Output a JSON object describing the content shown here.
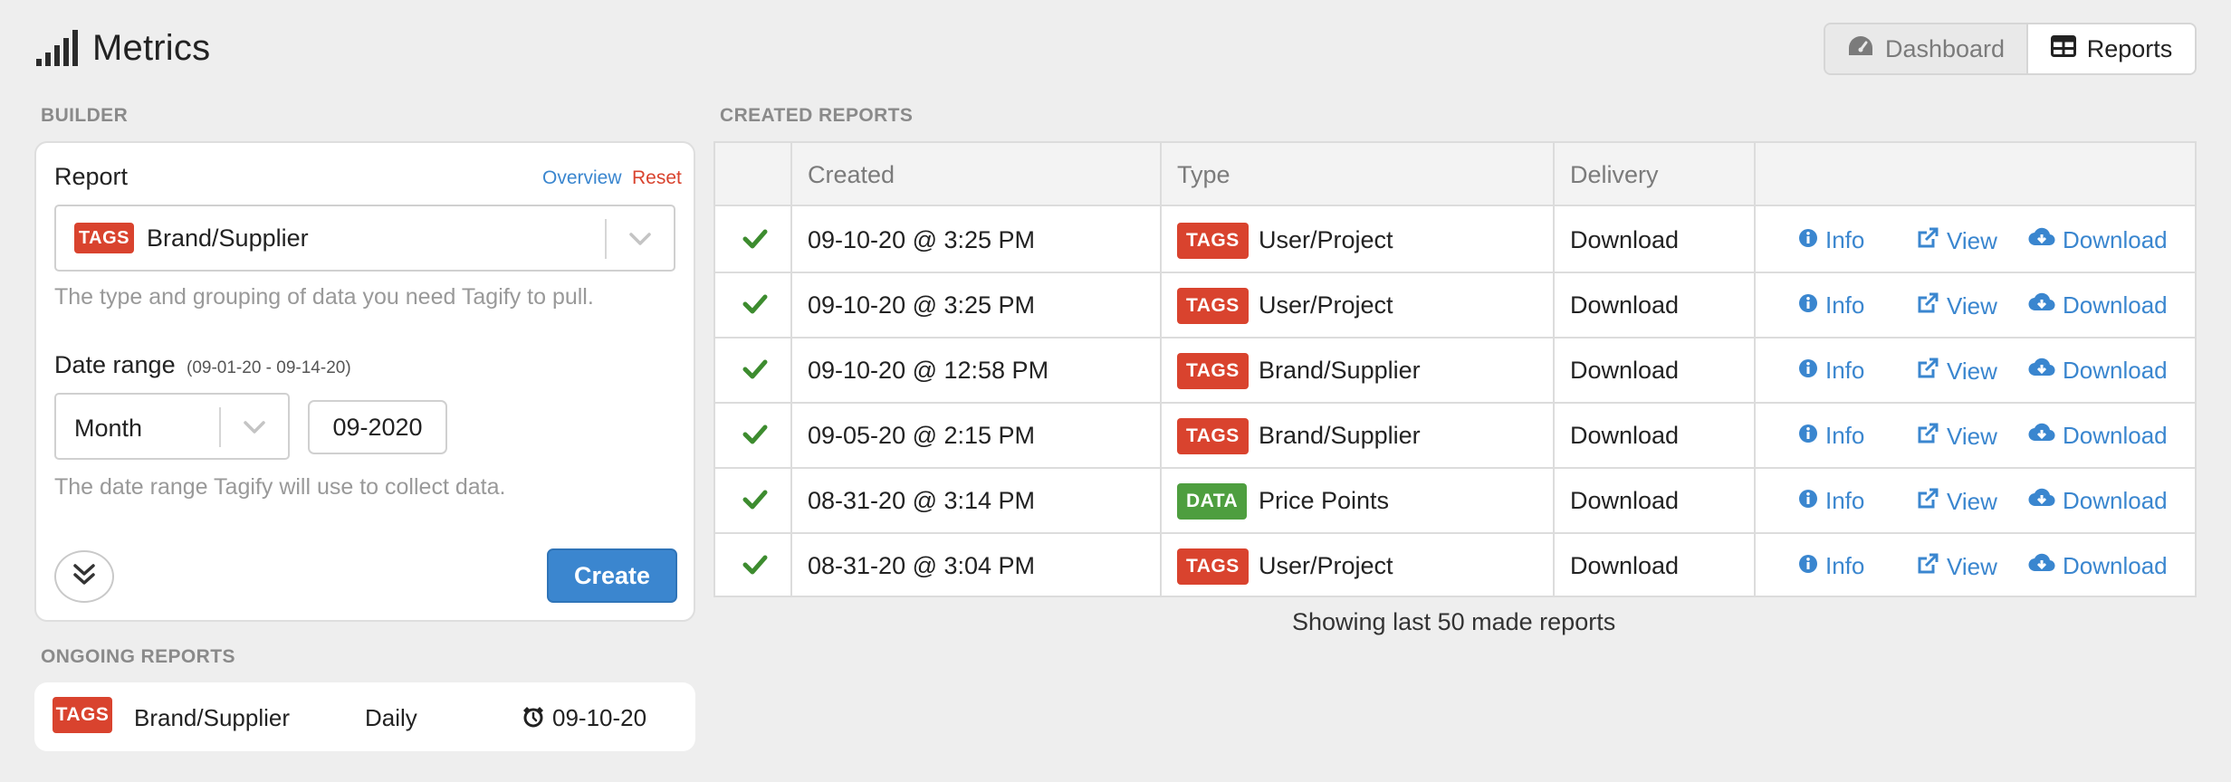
{
  "app": {
    "title": "Metrics"
  },
  "nav": {
    "dashboard_label": "Dashboard",
    "reports_label": "Reports"
  },
  "builder": {
    "section_label": "BUILDER",
    "report_label": "Report",
    "overview_link": "Overview",
    "reset_link": "Reset",
    "report_tag": "TAGS",
    "report_value": "Brand/Supplier",
    "report_help": "The type and grouping of data you need Tagify to pull.",
    "date_label": "Date range",
    "date_range_hint": "(09-01-20 - 09-14-20)",
    "period_value": "Month",
    "period_date": "09-2020",
    "date_help": "The date range Tagify will use to collect data.",
    "create_label": "Create"
  },
  "ongoing": {
    "section_label": "ONGOING REPORTS",
    "items": [
      {
        "tag": "TAGS",
        "name": "Brand/Supplier",
        "frequency": "Daily",
        "next_date": "09-10-20"
      }
    ]
  },
  "reports": {
    "section_label": "CREATED REPORTS",
    "columns": [
      "Created",
      "Type",
      "Delivery"
    ],
    "rows": [
      {
        "created": "09-10-20 @ 3:25 PM",
        "tag": "TAGS",
        "tag_color": "#d9432e",
        "type": "User/Project",
        "delivery": "Download"
      },
      {
        "created": "09-10-20 @ 3:25 PM",
        "tag": "TAGS",
        "tag_color": "#d9432e",
        "type": "User/Project",
        "delivery": "Download"
      },
      {
        "created": "09-10-20 @ 12:58 PM",
        "tag": "TAGS",
        "tag_color": "#d9432e",
        "type": "Brand/Supplier",
        "delivery": "Download"
      },
      {
        "created": "09-05-20 @ 2:15 PM",
        "tag": "TAGS",
        "tag_color": "#d9432e",
        "type": "Brand/Supplier",
        "delivery": "Download"
      },
      {
        "created": "08-31-20 @ 3:14 PM",
        "tag": "DATA",
        "tag_color": "#4e9e3f",
        "type": "Price Points",
        "delivery": "Download"
      },
      {
        "created": "08-31-20 @ 3:04 PM",
        "tag": "TAGS",
        "tag_color": "#d9432e",
        "type": "User/Project",
        "delivery": "Download"
      }
    ],
    "actions": {
      "info": "Info",
      "view": "View",
      "download": "Download"
    },
    "footer": "Showing last 50 made reports"
  },
  "colors": {
    "accent": "#3b86cf",
    "tag_red": "#d9432e",
    "tag_green": "#4e9e3f",
    "check_green": "#3d8c2f"
  },
  "icons": [
    "signal-bars-icon",
    "speedometer-icon",
    "table-icon",
    "chevron-down-icon",
    "double-chevron-down-icon",
    "alarm-clock-icon",
    "checkmark-icon",
    "info-circle-icon",
    "external-link-icon",
    "cloud-download-icon"
  ]
}
